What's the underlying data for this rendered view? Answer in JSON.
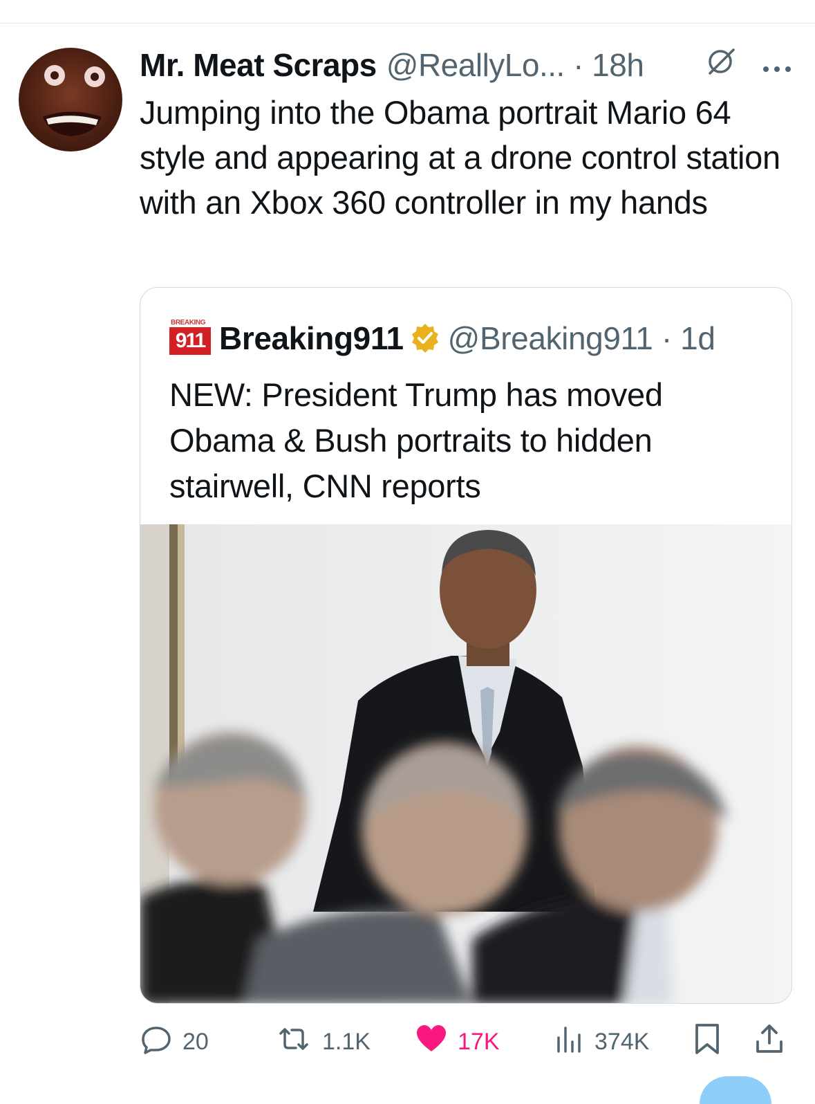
{
  "tweet": {
    "display_name": "Mr. Meat Scraps",
    "handle_time": "@ReallyLo... · 18h",
    "text": "Jumping into the Obama portrait Mario 64 style and appearing at a drone control station with an Xbox 360 controller in my hands",
    "icons": [
      "grok-icon",
      "more-icon"
    ]
  },
  "quote": {
    "avatar_top_text": "BREAKING",
    "avatar_number": "911",
    "display_name": "Breaking911",
    "handle_time": "@Breaking911 · 1d",
    "text": "NEW: President Trump has moved Obama & Bush portraits to hidden stairwell, CNN reports"
  },
  "actions": {
    "reply": "20",
    "repost": "1.1K",
    "like": "17K",
    "views": "374K"
  },
  "colors": {
    "text": "#0f1419",
    "secondary": "#536471",
    "like": "#f91880",
    "verified": "#e8b21e",
    "border": "#cfd9de"
  }
}
